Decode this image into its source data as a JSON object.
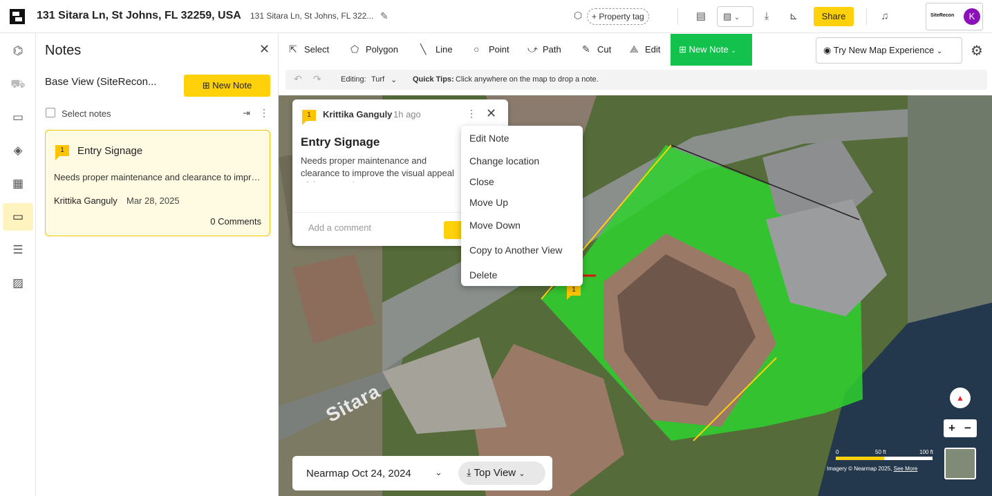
{
  "header": {
    "address": "131 Sitara Ln, St Johns, FL 32259, USA",
    "address_short": "131 Sitara Ln, St Johns, FL 322...",
    "property_tag_label": "+ Property tag",
    "share_label": "Share",
    "org_logo_text": "SiteRecon",
    "avatar_initial": "K",
    "icons": [
      "logo-icon",
      "edit-pencil-icon",
      "tag-icon",
      "document-settings-icon",
      "image-icon",
      "chevron-down-icon",
      "download-icon",
      "measure-icon",
      "bell-icon"
    ]
  },
  "sidebar_rail": {
    "icons": [
      "workflow-icon",
      "cart-icon",
      "folder-icon",
      "layers-icon",
      "calculator-icon",
      "notes-icon",
      "report-icon",
      "gallery-icon"
    ],
    "active": "notes-icon"
  },
  "notes_panel": {
    "title": "Notes",
    "base_view": "Base View (SiteRecon...",
    "new_note_label": "New Note",
    "select_notes_label": "Select notes",
    "card": {
      "number": "1",
      "title": "Entry Signage",
      "body": "Needs proper maintenance and clearance to improve the visual appeal of the entry signage.",
      "author": "Krittika Ganguly",
      "date": "Mar 28, 2025",
      "comments": "0 Comments"
    }
  },
  "toolbar": {
    "tools": [
      "Select",
      "Polygon",
      "Line",
      "Point",
      "Path",
      "Cut",
      "Edit"
    ],
    "new_note_label": "New Note",
    "map_experience_label": "Try New Map Experience"
  },
  "editbar": {
    "editing_label": "Editing:",
    "editing_value": "Turf",
    "quick_tips_label": "Quick Tips:",
    "quick_tips_text": "Click anywhere on the map to drop a note."
  },
  "note_popup": {
    "number": "1",
    "author": "Krittika Ganguly",
    "time": "1h ago",
    "title": "Entry Signage",
    "body": "Needs proper maintenance and clearance to improve the visual appeal of the entry signage.",
    "comment_placeholder": "Add a comment"
  },
  "context_menu": {
    "items": [
      "Edit Note",
      "Change location",
      "Close",
      "Move Up",
      "Move Down",
      "Copy to Another View",
      "Delete"
    ]
  },
  "map": {
    "pin_number": "1",
    "street_label": "Sitara",
    "scale_labels": [
      "0",
      "50 ft",
      "100 ft"
    ],
    "credit_prefix": "Imagery © Nearmap 2025,",
    "credit_link": "See More",
    "zoom_in": "+",
    "zoom_out": "−",
    "date": "Nearmap Oct 24, 2024",
    "view_mode": "Top View"
  }
}
